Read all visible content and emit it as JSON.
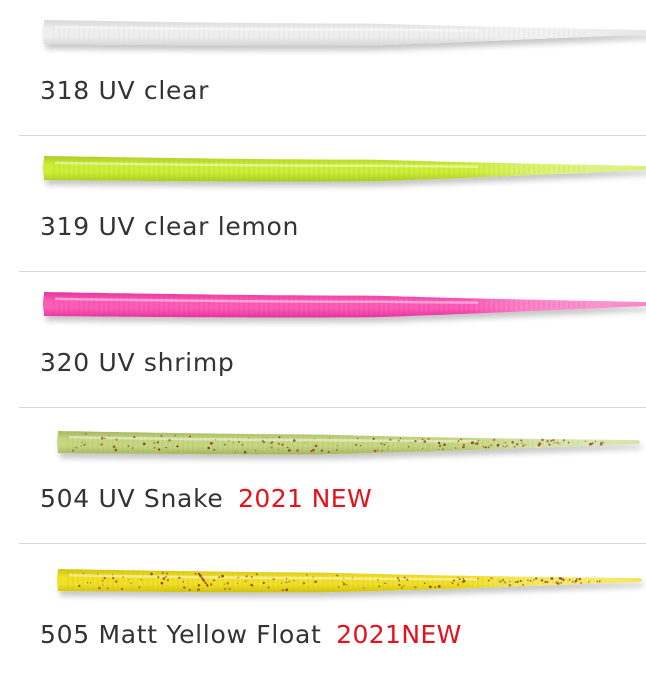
{
  "products": [
    {
      "code": "318",
      "name": "UV clear",
      "badge": "",
      "body_color": "#efefef",
      "edge_color": "#d7d7d7",
      "tip_color": "#e4e4e4",
      "speckled": false
    },
    {
      "code": "319",
      "name": "UV clear lemon",
      "badge": "",
      "body_color": "#cfee3a",
      "edge_color": "#a9cc20",
      "tip_color": "#d9f07a",
      "speckled": false
    },
    {
      "code": "320",
      "name": "UV shrimp",
      "badge": "",
      "body_color": "#fb5cb6",
      "edge_color": "#e6339b",
      "tip_color": "#fa84c9",
      "speckled": false
    },
    {
      "code": "504",
      "name": "UV Snake",
      "badge": "2021 NEW",
      "body_color": "#c6d681",
      "edge_color": "#a6b65f",
      "tip_color": "#d8e3a8",
      "speckled": true,
      "speck_color": "#8a3a1e"
    },
    {
      "code": "505",
      "name": "Matt Yellow Float",
      "badge": "2021NEW",
      "body_color": "#f0e02a",
      "edge_color": "#d2c10e",
      "tip_color": "#f3e45a",
      "speckled": true,
      "speck_color": "#8a3a1e"
    }
  ]
}
